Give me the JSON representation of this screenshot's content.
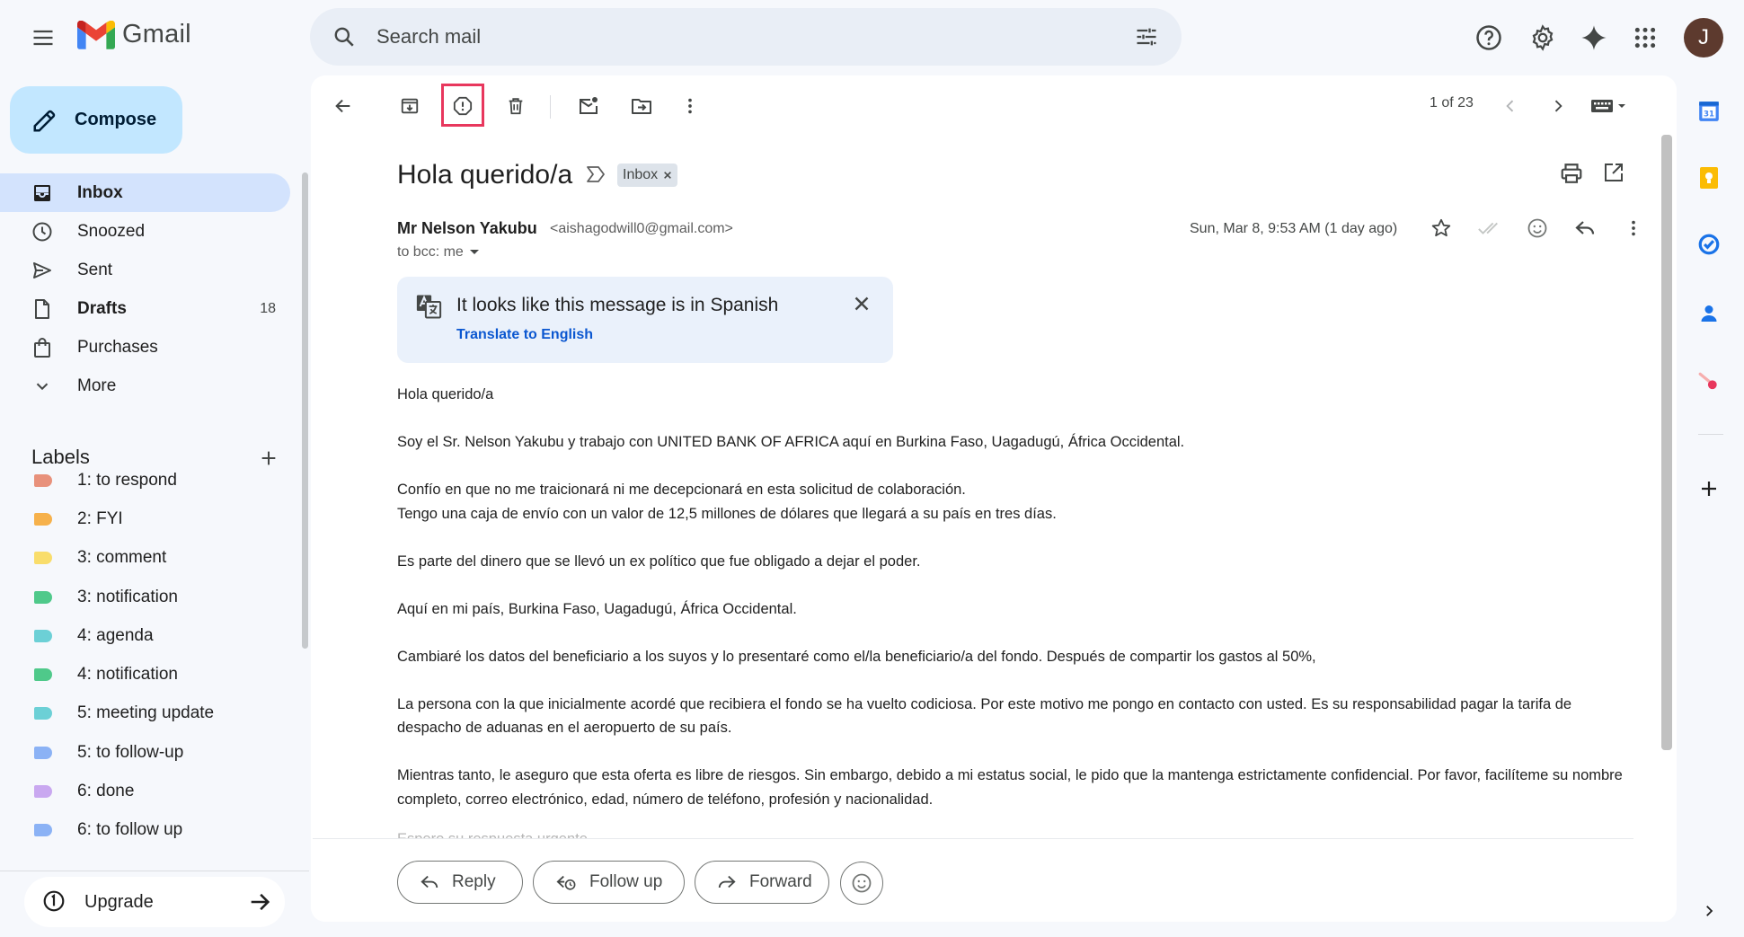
{
  "app": {
    "name": "Gmail"
  },
  "search": {
    "placeholder": "Search mail"
  },
  "account": {
    "initial": "J"
  },
  "sidebar": {
    "compose_label": "Compose",
    "nav": [
      {
        "label": "Inbox",
        "icon": "inbox-icon",
        "count": ""
      },
      {
        "label": "Snoozed",
        "icon": "clock-icon",
        "count": ""
      },
      {
        "label": "Sent",
        "icon": "send-icon",
        "count": ""
      },
      {
        "label": "Drafts",
        "icon": "draft-icon",
        "count": "18"
      },
      {
        "label": "Purchases",
        "icon": "shopping-bag-icon",
        "count": ""
      },
      {
        "label": "More",
        "icon": "chevron-down-icon",
        "count": ""
      }
    ],
    "labels_title": "Labels",
    "labels": [
      {
        "label": "1: to respond",
        "color": "#e8917b"
      },
      {
        "label": "2: FYI",
        "color": "#f6b14b"
      },
      {
        "label": "3: comment",
        "color": "#f9dd6b"
      },
      {
        "label": "3: notification",
        "color": "#4fc98a"
      },
      {
        "label": "4: agenda",
        "color": "#6cd0d6"
      },
      {
        "label": "4: notification",
        "color": "#4fc98a"
      },
      {
        "label": "5: meeting update",
        "color": "#6cd0d6"
      },
      {
        "label": "5: to follow-up",
        "color": "#8bb2f5"
      },
      {
        "label": "6: done",
        "color": "#c9a8f0"
      },
      {
        "label": "6: to follow up",
        "color": "#8bb2f5"
      }
    ],
    "upgrade_label": "Upgrade"
  },
  "toolbar": {
    "pager": "1 of 23",
    "highlighted_button": "report-spam"
  },
  "message": {
    "subject": "Hola querido/a",
    "folder_chip": "Inbox",
    "sender_name": "Mr Nelson Yakubu",
    "sender_email": "<aishagodwill0@gmail.com>",
    "recipients": "to bcc: me",
    "date": "Sun, Mar 8, 9:53 AM (1 day ago)",
    "translate_banner": {
      "text": "It looks like this message is in Spanish",
      "link": "Translate to English"
    },
    "body": [
      "Hola querido/a",
      "Soy el Sr. Nelson Yakubu y trabajo con UNITED BANK OF AFRICA aquí en Burkina Faso, Uagadugú, África Occidental.",
      "Confío en que no me traicionará ni me decepcionará en esta solicitud de colaboración.\nTengo una caja de envío con un valor de 12,5 millones de dólares que llegará a su país en tres días.",
      "Es parte del dinero que se llevó un ex político que fue obligado a dejar el poder.",
      "Aquí en mi país, Burkina Faso, Uagadugú, África Occidental.",
      "Cambiaré los datos del beneficiario a los suyos y lo presentaré como el/la beneficiario/a del fondo. Después de compartir los gastos al 50%,",
      "La persona con la que inicialmente acordé que recibiera el fondo se ha vuelto codiciosa. Por este motivo me pongo en contacto con usted. Es su responsabilidad pagar la tarifa de despacho de aduanas en el aeropuerto de su país.",
      "Mientras tanto, le aseguro que esta oferta es libre de riesgos. Sin embargo, debido a mi estatus social, le pido que la mantenga estrictamente confidencial. Por favor, facilíteme su nombre completo, correo electrónico, edad, número de teléfono, profesión y nacionalidad."
    ],
    "body_cutoff": "Espero su respuesta urgente."
  },
  "actions": {
    "reply": "Reply",
    "follow_up": "Follow up",
    "forward": "Forward"
  }
}
